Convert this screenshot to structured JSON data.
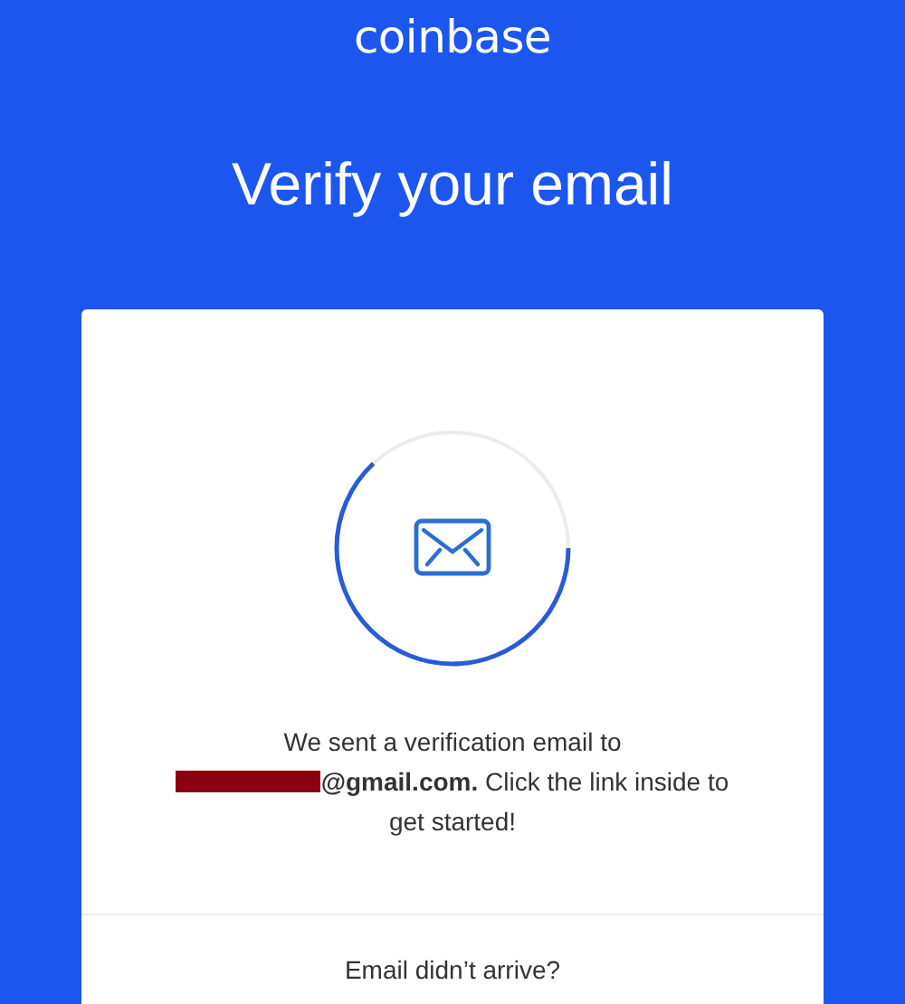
{
  "logo": "coinbase",
  "title": "Verify your email",
  "card": {
    "message_start": "We sent a verification email to",
    "email_redacted": true,
    "message_end": "**@gmail.com.** Click the link inside to get started!",
    "footer_link": "Email didn’t arrive?"
  }
}
